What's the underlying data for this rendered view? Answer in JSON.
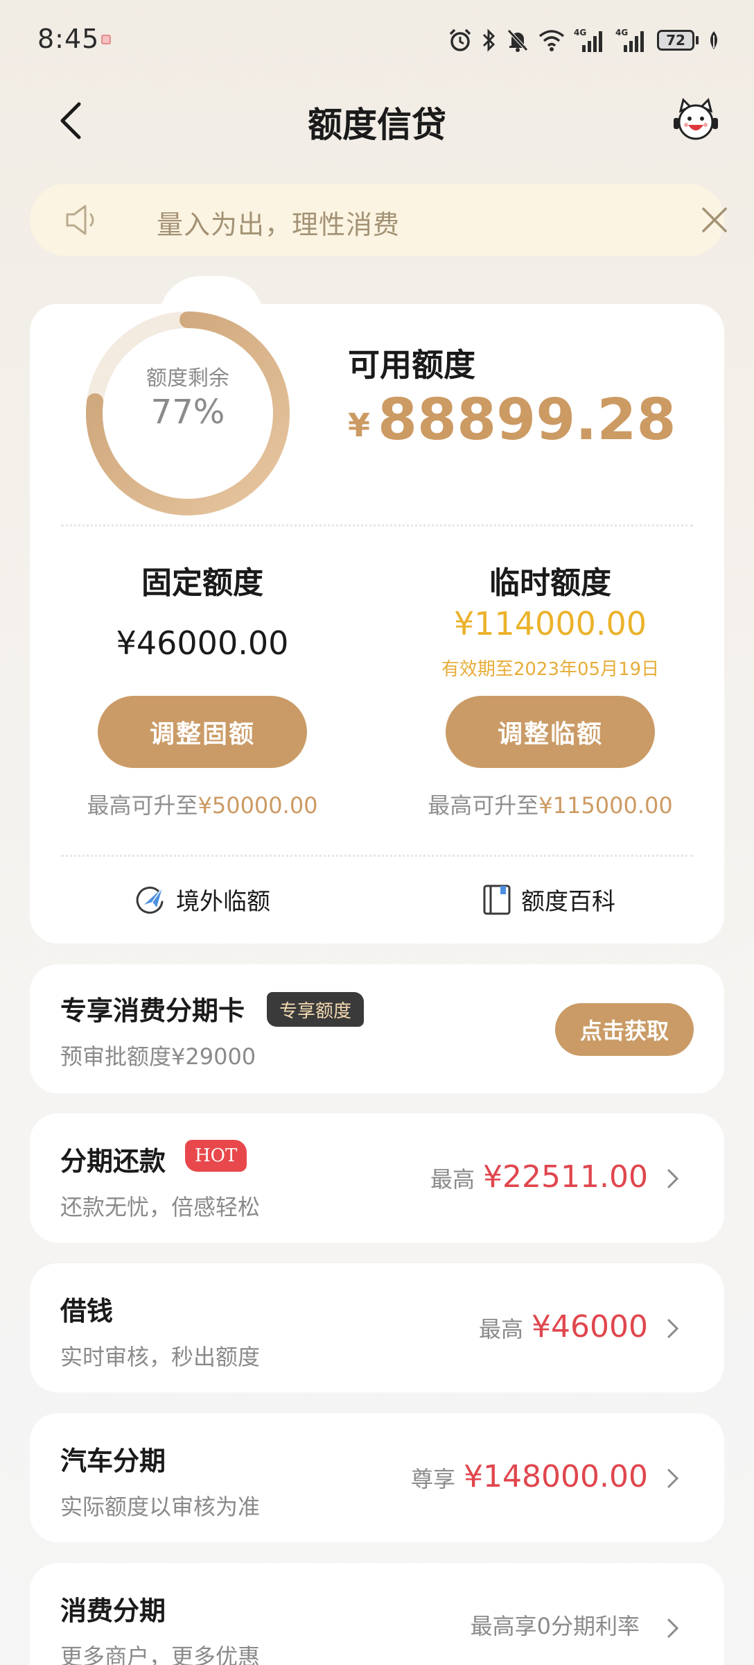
{
  "status_bar": {
    "time": "8:45",
    "network_left": "4G",
    "network_right": "4G",
    "battery": "72",
    "icons": [
      "alarm-icon",
      "bluetooth-icon",
      "mute-icon",
      "wifi-icon",
      "signal-icon",
      "signal-icon",
      "battery-icon",
      "leaf-icon"
    ]
  },
  "nav": {
    "title": "额度信贷",
    "back_icon": "back-arrow-icon",
    "service_icon": "mascot-service-icon"
  },
  "notice": {
    "text": "量入为出，理性消费",
    "icon": "speaker-icon",
    "close_icon": "close-icon"
  },
  "quota": {
    "ring_label": "额度剩余",
    "ring_percent": "77%",
    "ring_fraction": 0.77,
    "available_label": "可用额度",
    "available_currency": "¥",
    "available_amount": "88899.28",
    "fixed": {
      "title": "固定额度",
      "amount": "¥46000.00",
      "button": "调整固额",
      "max_prefix": "最高可升至",
      "max_value": "¥50000.00"
    },
    "temporary": {
      "title": "临时额度",
      "amount": "¥114000.00",
      "validity": "有效期至2023年05月19日",
      "button": "调整临额",
      "max_prefix": "最高可升至",
      "max_value": "¥115000.00"
    },
    "links": [
      {
        "label": "境外临额",
        "icon": "overseas-plane-icon"
      },
      {
        "label": "额度百科",
        "icon": "book-icon"
      }
    ]
  },
  "exclusive": {
    "title": "专享消费分期卡",
    "badge": "专享额度",
    "subtitle": "预审批额度¥29000",
    "button": "点击获取"
  },
  "items": [
    {
      "title": "分期还款",
      "badge": "HOT",
      "subtitle": "还款无忧，倍感轻松",
      "prefix": "最高",
      "amount": "¥22511.00"
    },
    {
      "title": "借钱",
      "subtitle": "实时审核，秒出额度",
      "prefix": "最高",
      "amount": "¥46000"
    },
    {
      "title": "汽车分期",
      "subtitle": "实际额度以审核为准",
      "prefix": "尊享",
      "amount": "¥148000.00"
    },
    {
      "title": "消费分期",
      "subtitle": "更多商户，更多优惠",
      "prefix": "最高享0分期利率",
      "amount": ""
    }
  ],
  "colors": {
    "gold": "#ca9b66",
    "gold_text": "#cc9a63",
    "yellow": "#ebb22a",
    "red": "#e0464d",
    "notice_bg": "#fcf4e2"
  }
}
